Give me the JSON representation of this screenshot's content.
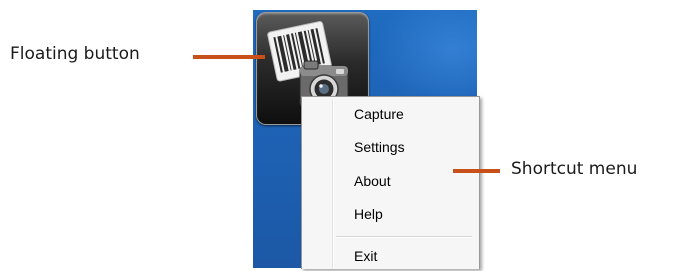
{
  "annotations": {
    "floating_button": "Floating button",
    "shortcut_menu": "Shortcut menu"
  },
  "floating_button": {
    "icon": "barcode-camera-icon"
  },
  "menu": {
    "items": [
      {
        "label": "Capture"
      },
      {
        "label": "Settings"
      },
      {
        "label": "About"
      },
      {
        "label": "Help"
      },
      {
        "label": "Exit"
      }
    ]
  },
  "colors": {
    "callout": "#c8501a",
    "desktop": "#1e63b6",
    "menu_bg": "#f6f6f6"
  }
}
